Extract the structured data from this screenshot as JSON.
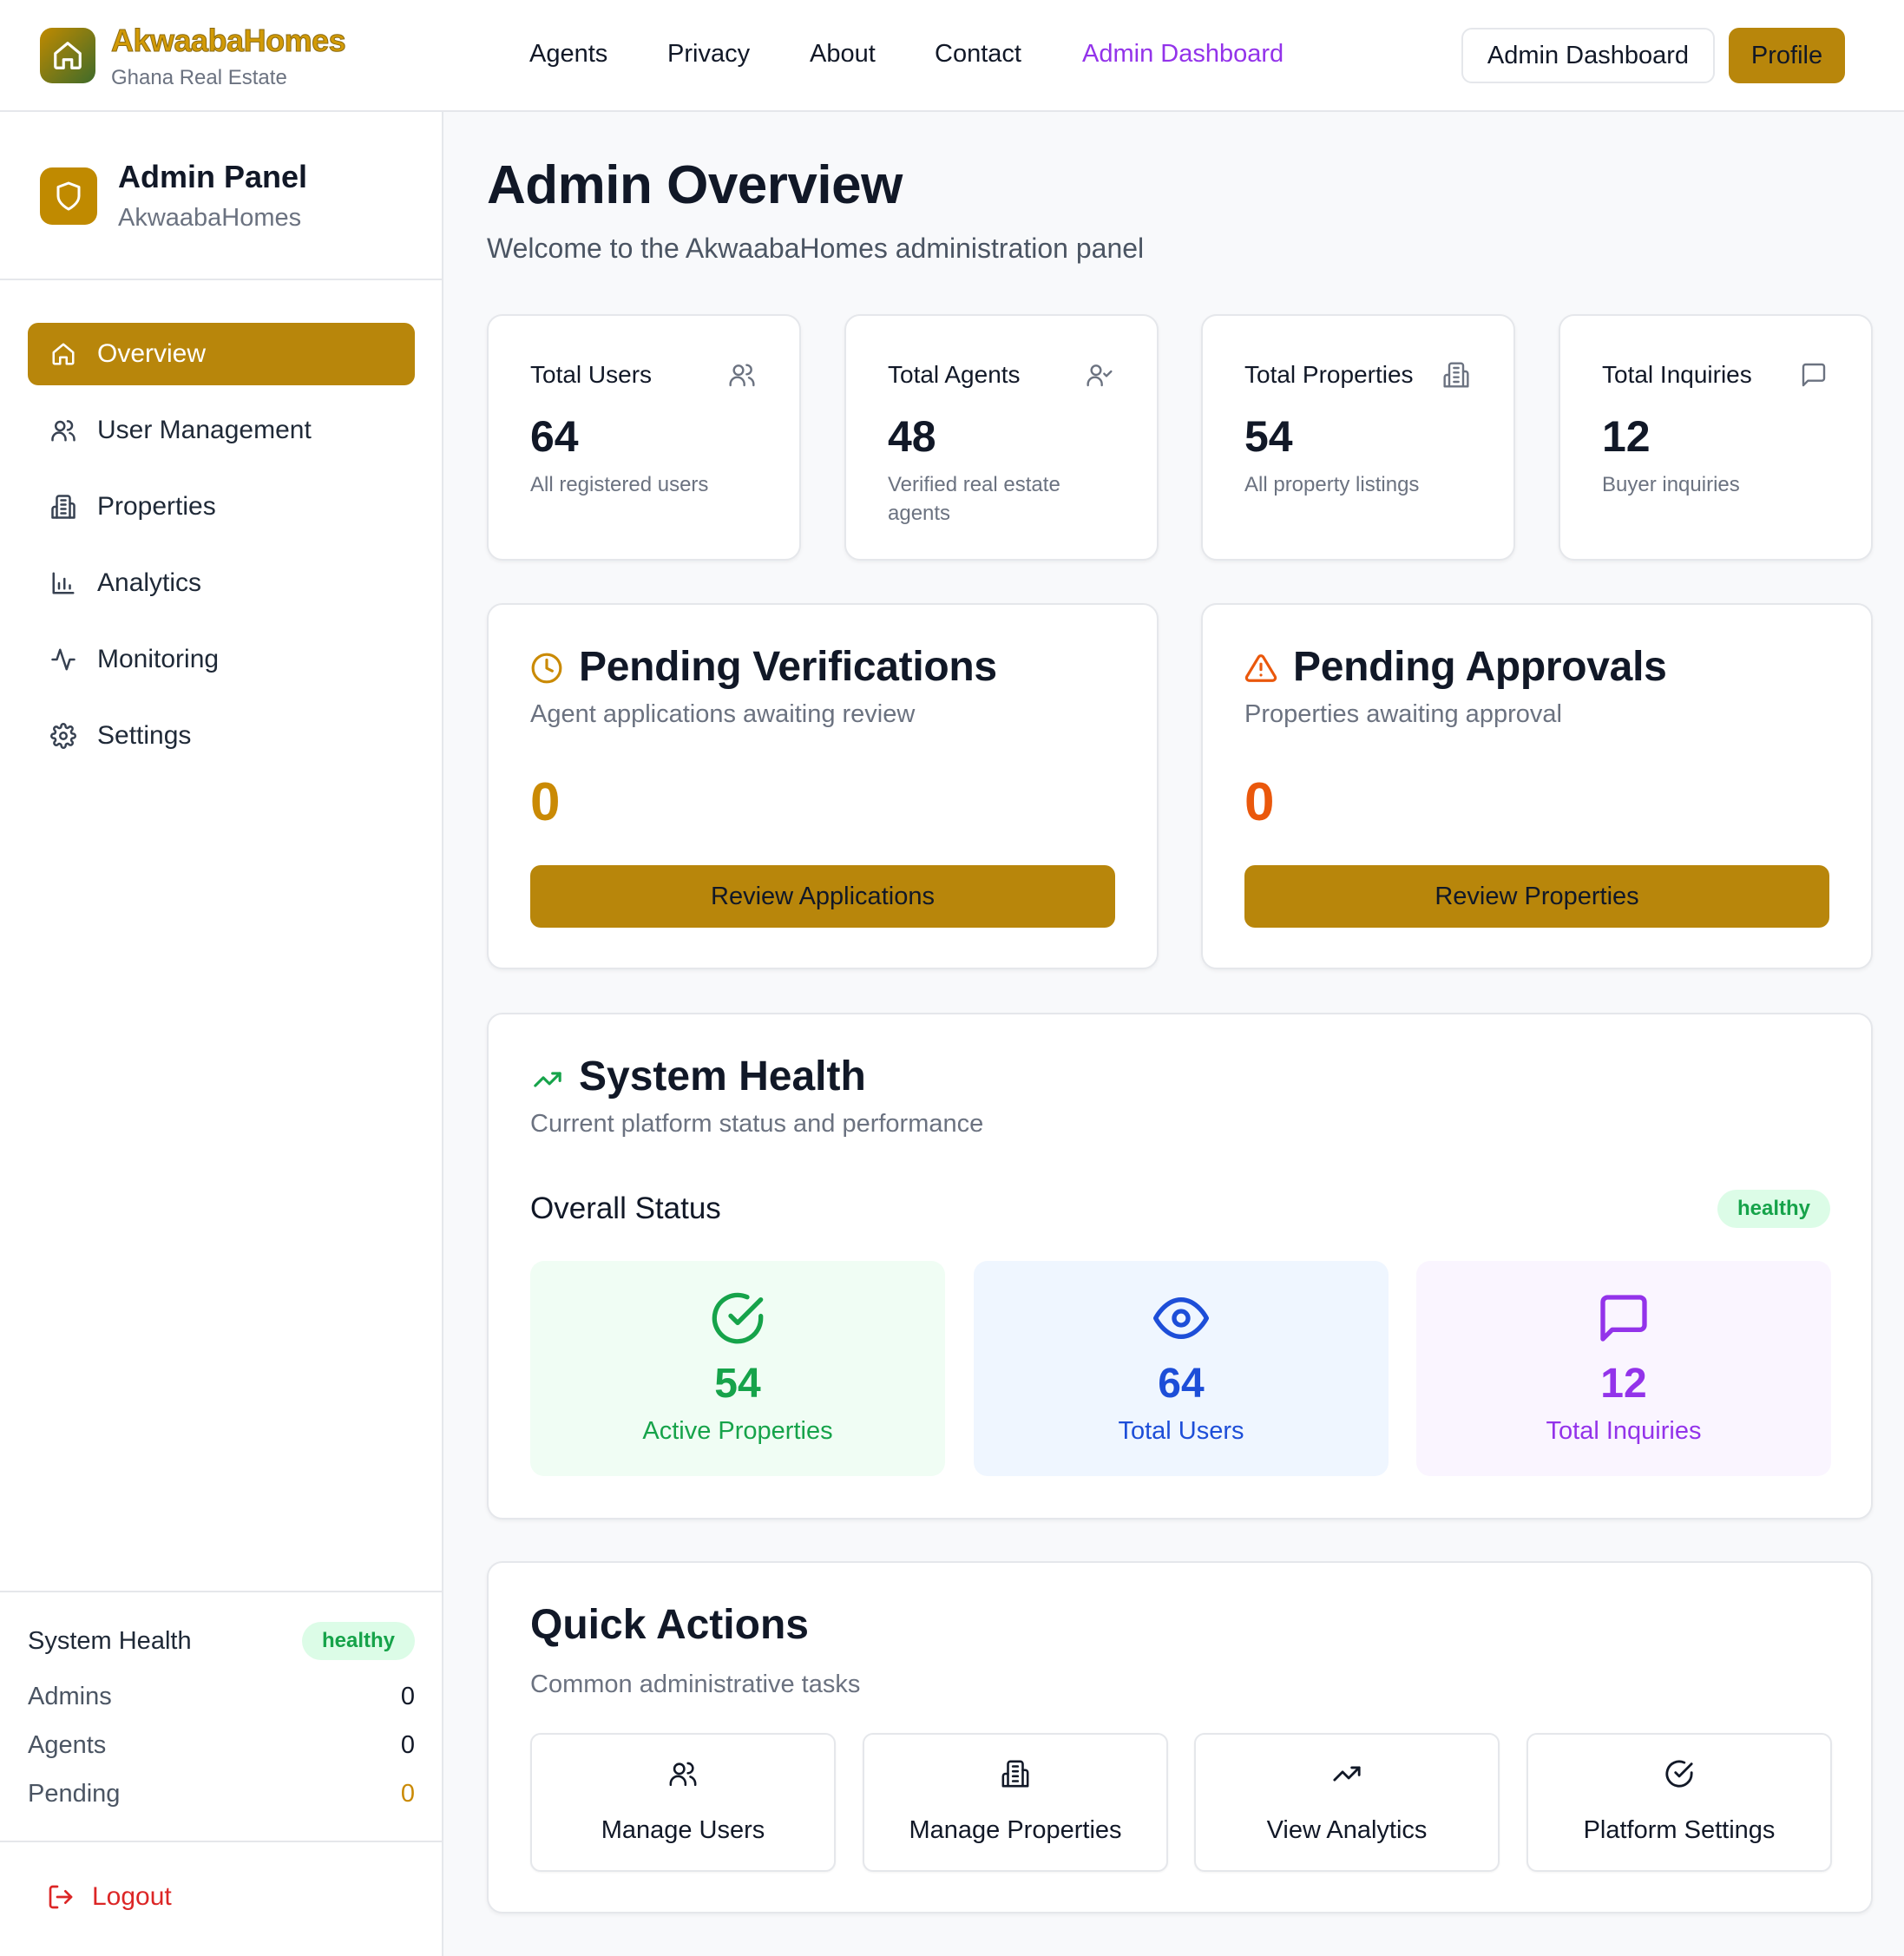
{
  "brand": {
    "name": "AkwaabaHomes",
    "tagline": "Ghana Real Estate"
  },
  "nav": {
    "links": [
      "Agents",
      "Privacy",
      "About",
      "Contact",
      "Admin Dashboard"
    ],
    "active_color": "#9333ea",
    "admin_button": "Admin Dashboard",
    "profile_button": "Profile"
  },
  "colors": {
    "accent": "#b8860b",
    "healthy_bg": "#dcfce7",
    "healthy_text": "#16a34a",
    "danger": "#dc2626"
  },
  "sidebar": {
    "title": "Admin Panel",
    "subtitle": "AkwaabaHomes",
    "items": [
      {
        "label": "Overview",
        "icon": "home-icon",
        "active": true
      },
      {
        "label": "User Management",
        "icon": "users-icon"
      },
      {
        "label": "Properties",
        "icon": "building-icon"
      },
      {
        "label": "Analytics",
        "icon": "bar-chart-icon"
      },
      {
        "label": "Monitoring",
        "icon": "activity-icon"
      },
      {
        "label": "Settings",
        "icon": "gear-icon"
      }
    ],
    "health": {
      "title": "System Health",
      "status": "healthy",
      "rows": [
        {
          "label": "Admins",
          "value": "0"
        },
        {
          "label": "Agents",
          "value": "0"
        },
        {
          "label": "Pending",
          "value": "0"
        }
      ]
    },
    "logout": "Logout"
  },
  "main": {
    "title": "Admin Overview",
    "subtitle": "Welcome to the AkwaabaHomes administration panel",
    "stats": [
      {
        "label": "Total Users",
        "value": "64",
        "desc": "All registered users",
        "icon": "users-icon"
      },
      {
        "label": "Total Agents",
        "value": "48",
        "desc": "Verified real estate agents",
        "icon": "user-check-icon"
      },
      {
        "label": "Total Properties",
        "value": "54",
        "desc": "All property listings",
        "icon": "building-icon"
      },
      {
        "label": "Total Inquiries",
        "value": "12",
        "desc": "Buyer inquiries",
        "icon": "message-icon"
      }
    ],
    "pending": [
      {
        "title": "Pending Verifications",
        "subtitle": "Agent applications awaiting review",
        "value": "0",
        "button": "Review Applications",
        "icon": "clock-icon",
        "color": "#ca8a04"
      },
      {
        "title": "Pending Approvals",
        "subtitle": "Properties awaiting approval",
        "value": "0",
        "button": "Review Properties",
        "icon": "alert-triangle-icon",
        "color": "#ea580c"
      }
    ],
    "system_health": {
      "title": "System Health",
      "subtitle": "Current platform status and performance",
      "overall_label": "Overall Status",
      "status": "healthy",
      "tiles": [
        {
          "value": "54",
          "label": "Active Properties",
          "icon": "check-circle-icon",
          "color": "#16a34a",
          "bg": "#f0fdf4"
        },
        {
          "value": "64",
          "label": "Total Users",
          "icon": "eye-icon",
          "color": "#1d4ed8",
          "bg": "#eff6ff"
        },
        {
          "value": "12",
          "label": "Total Inquiries",
          "icon": "message-square-icon",
          "color": "#9333ea",
          "bg": "#faf5ff"
        }
      ]
    },
    "quick_actions": {
      "title": "Quick Actions",
      "subtitle": "Common administrative tasks",
      "items": [
        {
          "label": "Manage Users",
          "icon": "users-icon"
        },
        {
          "label": "Manage Properties",
          "icon": "building-icon"
        },
        {
          "label": "View Analytics",
          "icon": "trending-up-icon"
        },
        {
          "label": "Platform Settings",
          "icon": "check-circle-icon"
        }
      ]
    }
  }
}
